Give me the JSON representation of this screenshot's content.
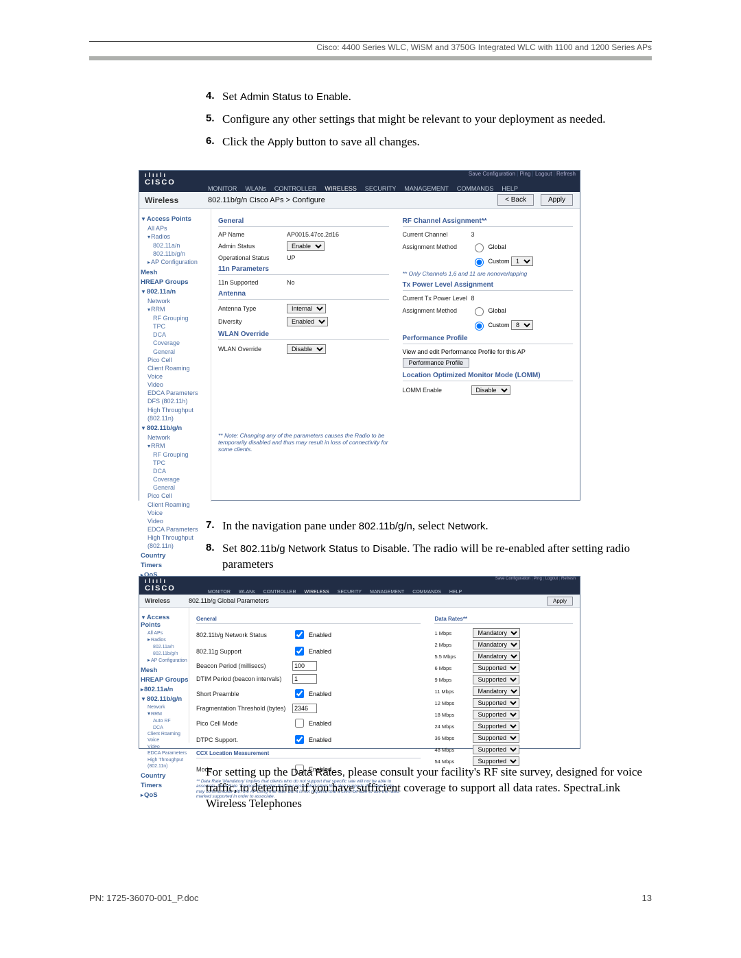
{
  "header_right": "Cisco: 4400 Series WLC, WiSM and 3750G Integrated WLC with 1100 and 1200 Series APs",
  "steps1": {
    "4": "Set Admin Status to Enable.",
    "5": "Configure any other settings that might be relevant to your deployment as needed.",
    "6a": "Click the ",
    "6b": "Apply",
    "6c": " button to save all changes."
  },
  "steps2": {
    "7a": "In the navigation pane under ",
    "7b": "802.11b/g/n",
    "7c": ", select ",
    "7d": "Network",
    "7e": ".",
    "8a": "Set ",
    "8b": "802.11b/g Network Status",
    "8c": " to ",
    "8d": "Disable",
    "8e": ". The radio will be re-enabled after setting radio parameters"
  },
  "body3": "For setting up the Data Rates, please consult your facility's RF site survey, designed for voice traffic, to determine if you have sufficient coverage to support all data rates. SpectraLink Wireless Telephones",
  "body3_inline": "Data Rates,",
  "footer_left": "PN: 1725-36070-001_P.doc",
  "footer_right": "13",
  "cisco_brand": "CISCO",
  "cisco_bars": "ılıılı",
  "topmenu": [
    "MONITOR",
    "WLANs",
    "CONTROLLER",
    "WIRELESS",
    "SECURITY",
    "MANAGEMENT",
    "COMMANDS",
    "HELP"
  ],
  "tblinks": [
    "Save Configuration",
    "Ping",
    "Logout",
    "Refresh"
  ],
  "shot1": {
    "sidehdr": "Wireless",
    "crumb": "802.11b/g/n Cisco APs > Configure",
    "back": "< Back",
    "apply": "Apply",
    "sidebar": {
      "access_points": "Access Points",
      "all_aps": "All APs",
      "radios": "Radios",
      "r1": "802.11a/n",
      "r2": "802.11b/g/n",
      "ap_conf": "AP Configuration",
      "mesh": "Mesh",
      "hreap": "HREAP Groups",
      "an": "802.11a/n",
      "network": "Network",
      "rrm": "RRM",
      "rf_grouping": "RF Grouping",
      "tpc": "TPC",
      "dca": "DCA",
      "coverage": "Coverage",
      "general": "General",
      "pico": "Pico Cell",
      "client_roaming": "Client Roaming",
      "voice": "Voice",
      "video": "Video",
      "edca": "EDCA Parameters",
      "dfs": "DFS (802.11h)",
      "ht": "High Throughput (802.11n)",
      "bgn": "802.11b/g/n",
      "country": "Country",
      "timers": "Timers",
      "qos": "QoS"
    },
    "general_sec": "General",
    "ap_name_lbl": "AP Name",
    "ap_name_val": "AP0015.47cc.2d16",
    "admin_status_lbl": "Admin Status",
    "admin_status_val": "Enable",
    "op_status_lbl": "Operational Status",
    "op_status_val": "UP",
    "n11_sec": "11n Parameters",
    "n11_lbl": "11n Supported",
    "n11_val": "No",
    "antenna_sec": "Antenna",
    "antenna_type_lbl": "Antenna Type",
    "antenna_type_val": "Internal",
    "diversity_lbl": "Diversity",
    "diversity_val": "Enabled",
    "wlan_ovr_sec": "WLAN Override",
    "wlan_ovr_lbl": "WLAN Override",
    "wlan_ovr_val": "Disable",
    "rf_sec": "RF Channel Assignment**",
    "cur_ch_lbl": "Current Channel",
    "cur_ch_val": "3",
    "asgn_lbl": "Assignment Method",
    "asgn_global": "Global",
    "asgn_custom": "Custom",
    "asgn_custom_val": "1",
    "rf_note": "** Only Channels 1,6 and 11 are nonoverlapping",
    "tx_sec": "Tx Power Level Assignment",
    "cur_tx_lbl": "Current Tx Power Level",
    "cur_tx_val": "8",
    "tx_custom_val": "8",
    "perf_sec": "Performance Profile",
    "perf_text": "View and edit Performance Profile for this AP",
    "perf_btn": "Performance Profile",
    "lomm_sec": "Location Optimized Monitor Mode (LOMM)",
    "lomm_lbl": "LOMM Enable",
    "lomm_val": "Disable",
    "bottom_note": "** Note: Changing any of the parameters causes the Radio to be temporarily disabled and thus may result in loss of connectivity for some clients."
  },
  "shot2": {
    "sidehdr": "Wireless",
    "crumb": "802.11b/g Global Parameters",
    "apply": "Apply",
    "general_sec": "General",
    "datarates_sec": "Data Rates**",
    "nw_status_lbl": "802.11b/g Network Status",
    "enabled": "Enabled",
    "g_support_lbl": "802.11g Support",
    "beacon_lbl": "Beacon Period (millisecs)",
    "beacon_val": "100",
    "dtim_lbl": "DTIM Period (beacon intervals)",
    "dtim_val": "1",
    "short_pre_lbl": "Short Preamble",
    "frag_lbl": "Fragmentation Threshold (bytes)",
    "frag_val": "2346",
    "pico_lbl": "Pico Cell Mode",
    "dtpc_lbl": "DTPC Support.",
    "ccx_sec": "CCX Location Measurement",
    "ccx_mode_lbl": "Mode",
    "rates": [
      {
        "lbl": "1 Mbps",
        "val": "Mandatory"
      },
      {
        "lbl": "2 Mbps",
        "val": "Mandatory"
      },
      {
        "lbl": "5.5 Mbps",
        "val": "Mandatory"
      },
      {
        "lbl": "6 Mbps",
        "val": "Supported"
      },
      {
        "lbl": "9 Mbps",
        "val": "Supported"
      },
      {
        "lbl": "11 Mbps",
        "val": "Mandatory"
      },
      {
        "lbl": "12 Mbps",
        "val": "Supported"
      },
      {
        "lbl": "18 Mbps",
        "val": "Supported"
      },
      {
        "lbl": "24 Mbps",
        "val": "Supported"
      },
      {
        "lbl": "36 Mbps",
        "val": "Supported"
      },
      {
        "lbl": "48 Mbps",
        "val": "Supported"
      },
      {
        "lbl": "54 Mbps",
        "val": "Supported"
      }
    ],
    "footnote": "** Data Rate 'Mandatory' implies that clients who do not support that specific rate will not be able to associate. Data Rate 'Supported' implies that any associated client that also supports that same rate may communicate with the AP using that rate. But it is not required that a client be able to use the rates marked supported in order to associate."
  }
}
